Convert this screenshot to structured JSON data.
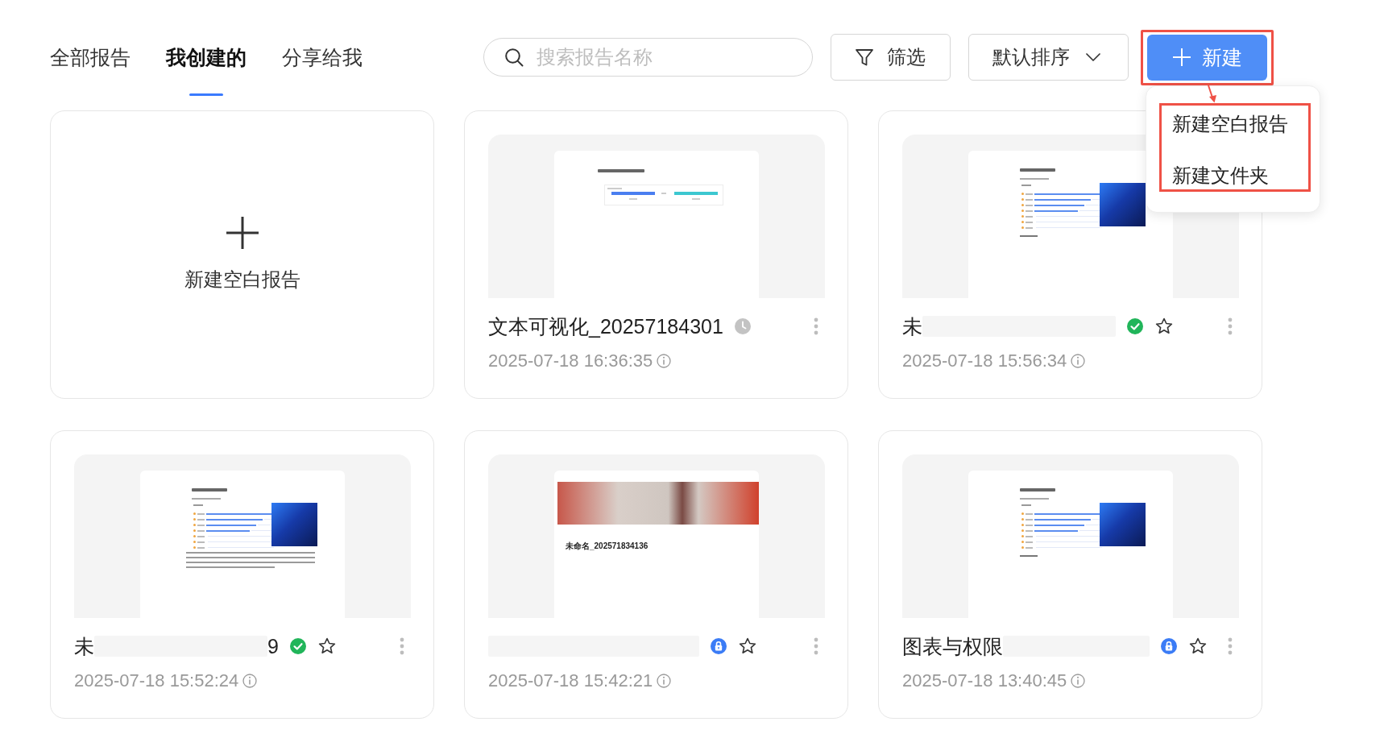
{
  "tabs": [
    {
      "label": "全部报告",
      "selected": false
    },
    {
      "label": "我创建的",
      "selected": true
    },
    {
      "label": "分享给我",
      "selected": false
    }
  ],
  "search": {
    "placeholder": "搜索报告名称"
  },
  "filter_button": {
    "label": "筛选"
  },
  "sort_button": {
    "label": "默认排序"
  },
  "new_button": {
    "label": "新建",
    "highlighted": true
  },
  "new_menu": {
    "highlighted": true,
    "arrow": true,
    "items": [
      {
        "label": "新建空白报告"
      },
      {
        "label": "新建文件夹"
      }
    ]
  },
  "new_card": {
    "label": "新建空白报告"
  },
  "cards": [
    {
      "thumbnail": {
        "kind": "compare"
      },
      "title_parts": [
        {
          "kind": "text",
          "text": "文本可视化_20257184301"
        }
      ],
      "status": {
        "kind": "pending"
      },
      "time": "2025-07-18 16:36:35"
    },
    {
      "thumbnail": {
        "kind": "chart"
      },
      "title_parts": [
        {
          "kind": "text",
          "text": "未"
        },
        {
          "kind": "redacted"
        }
      ],
      "status": {
        "kind": "published"
      },
      "starred": false,
      "time": "2025-07-18 15:56:34"
    },
    {
      "thumbnail": {
        "kind": "chart_text"
      },
      "title_parts": [
        {
          "kind": "text",
          "text": "未"
        },
        {
          "kind": "redacted"
        },
        {
          "kind": "text",
          "text": "9"
        }
      ],
      "status": {
        "kind": "published"
      },
      "starred": false,
      "time": "2025-07-18 15:52:24"
    },
    {
      "thumbnail": {
        "kind": "banner",
        "title": "未命名_202571834136"
      },
      "title_parts": [
        {
          "kind": "redacted"
        }
      ],
      "status": {
        "kind": "locked"
      },
      "starred": false,
      "time": "2025-07-18 15:42:21"
    },
    {
      "thumbnail": {
        "kind": "chart"
      },
      "title_parts": [
        {
          "kind": "text",
          "text": "图表与权限"
        },
        {
          "kind": "redacted"
        }
      ],
      "status": {
        "kind": "locked"
      },
      "starred": false,
      "time": "2025-07-18 13:40:45"
    }
  ]
}
